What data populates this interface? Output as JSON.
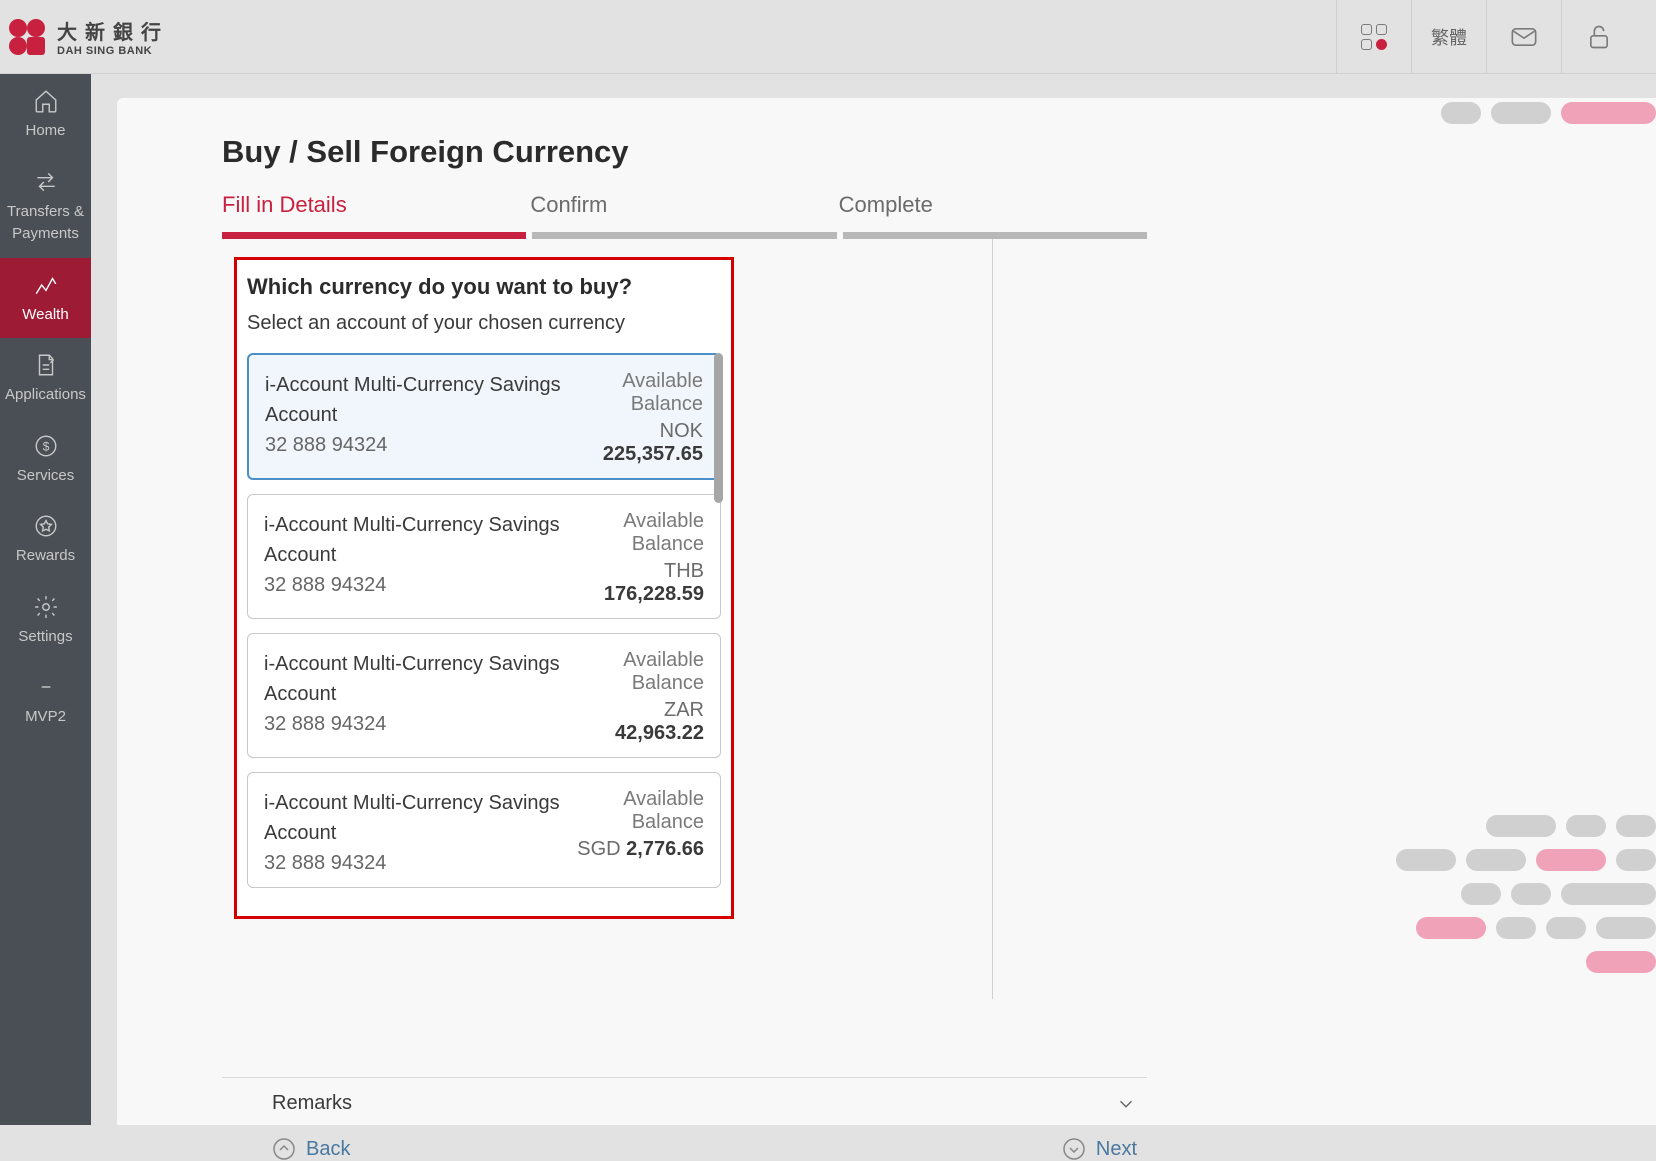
{
  "header": {
    "bank_name_cn": "大新銀行",
    "bank_name_en": "DAH SING BANK",
    "lang_label": "繁體"
  },
  "sidebar": {
    "items": [
      {
        "label": "Home"
      },
      {
        "label": "Transfers & Payments"
      },
      {
        "label": "Wealth"
      },
      {
        "label": "Applications"
      },
      {
        "label": "Services"
      },
      {
        "label": "Rewards"
      },
      {
        "label": "Settings"
      },
      {
        "label": "MVP2"
      }
    ]
  },
  "page": {
    "title": "Buy / Sell Foreign Currency",
    "steps": [
      {
        "label": "Fill in Details",
        "active": true
      },
      {
        "label": "Confirm",
        "active": false
      },
      {
        "label": "Complete",
        "active": false
      }
    ],
    "question_title": "Which currency do you want to buy?",
    "question_sub": "Select an account of your chosen currency",
    "balance_label": "Available Balance",
    "accounts": [
      {
        "name": "i-Account Multi-Currency Savings Account",
        "number": "32 888 94324",
        "ccy": "NOK",
        "amount": "225,357.65",
        "selected": true
      },
      {
        "name": "i-Account Multi-Currency Savings Account",
        "number": "32 888 94324",
        "ccy": "THB",
        "amount": "176,228.59",
        "selected": false
      },
      {
        "name": "i-Account Multi-Currency Savings Account",
        "number": "32 888 94324",
        "ccy": "ZAR",
        "amount": "42,963.22",
        "selected": false
      },
      {
        "name": "i-Account Multi-Currency Savings Account",
        "number": "32 888 94324",
        "ccy": "SGD",
        "amount": "2,776.66",
        "selected": false
      }
    ],
    "remarks_label": "Remarks",
    "back_label": "Back",
    "next_label": "Next"
  }
}
